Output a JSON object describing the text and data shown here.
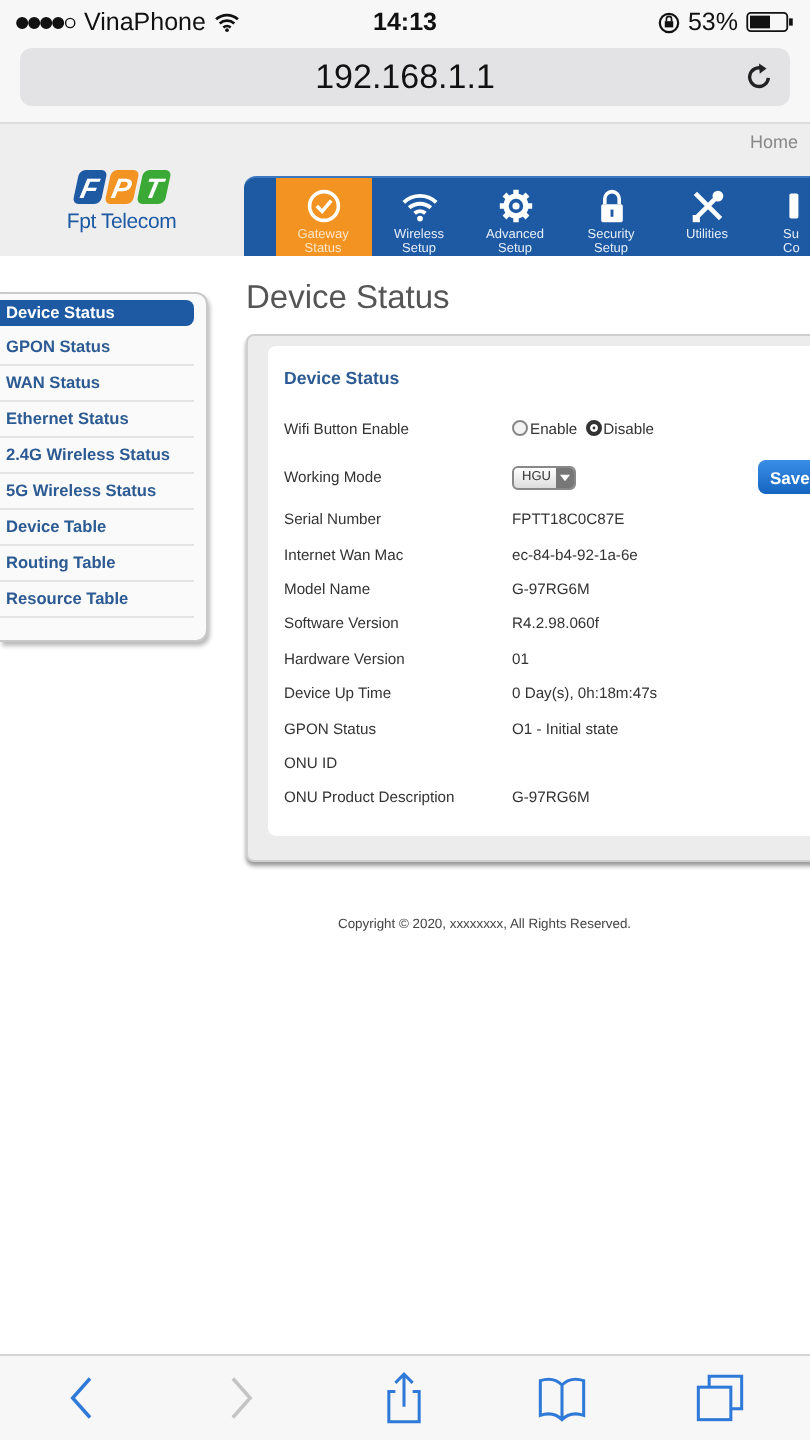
{
  "status_bar": {
    "carrier": "VinaPhone",
    "time": "14:13",
    "battery": "53%"
  },
  "url_bar": {
    "address": "192.168.1.1"
  },
  "header": {
    "breadcrumb": "Home",
    "logo": {
      "letters": [
        "F",
        "P",
        "T"
      ],
      "name": "Fpt Telecom"
    }
  },
  "nav": [
    {
      "kind": "check",
      "lines": [
        "Gateway",
        "Status"
      ],
      "selected": true
    },
    {
      "kind": "wifi",
      "lines": [
        "Wireless",
        "Setup"
      ],
      "selected": false
    },
    {
      "kind": "gear",
      "lines": [
        "Advanced",
        "Setup"
      ],
      "selected": false
    },
    {
      "kind": "lock",
      "lines": [
        "Security",
        "Setup"
      ],
      "selected": false
    },
    {
      "kind": "tools",
      "lines": [
        "Utilities"
      ],
      "selected": false
    },
    {
      "kind": "partial",
      "lines": [
        "Su",
        "Co"
      ],
      "selected": false
    }
  ],
  "sidebar": {
    "items": [
      {
        "label": "Device Status",
        "selected": true
      },
      {
        "label": "GPON Status",
        "selected": false
      },
      {
        "label": "WAN Status",
        "selected": false
      },
      {
        "label": "Ethernet Status",
        "selected": false
      },
      {
        "label": "2.4G Wireless Status",
        "selected": false
      },
      {
        "label": "5G Wireless Status",
        "selected": false
      },
      {
        "label": "Device Table",
        "selected": false
      },
      {
        "label": "Routing Table",
        "selected": false
      },
      {
        "label": "Resource Table",
        "selected": false
      }
    ]
  },
  "main": {
    "title": "Device Status",
    "panel_title": "Device Status",
    "rows": [
      {
        "kind": "radio",
        "label": "Wifi Button Enable",
        "options": [
          {
            "label": "Enable",
            "selected": false
          },
          {
            "label": "Disable",
            "selected": true
          }
        ]
      },
      {
        "kind": "select",
        "label": "Working Mode",
        "value": "HGU",
        "button": "Save"
      },
      {
        "kind": "text",
        "label": "Serial Number",
        "value": "FPTT18C0C87E"
      },
      {
        "kind": "text",
        "label": "Internet Wan Mac",
        "value": "ec-84-b4-92-1a-6e"
      },
      {
        "kind": "text",
        "label": "Model Name",
        "value": "G-97RG6M"
      },
      {
        "kind": "text",
        "label": "Software Version",
        "value": "R4.2.98.060f"
      },
      {
        "kind": "text",
        "label": "Hardware Version",
        "value": "01"
      },
      {
        "kind": "text",
        "label": "Device Up Time",
        "value": "0 Day(s), 0h:18m:47s"
      },
      {
        "kind": "text",
        "label": "GPON Status",
        "value": "O1 - Initial state"
      },
      {
        "kind": "text",
        "label": "ONU ID"
      },
      {
        "kind": "text",
        "label": "ONU Product Description",
        "value": "G-97RG6M"
      }
    ]
  },
  "footer": {
    "copyright": "Copyright © 2020, xxxxxxxx, All Rights Reserved."
  },
  "toolbar": {
    "buttons": [
      {
        "kind": "back",
        "disabled": false
      },
      {
        "kind": "forward",
        "disabled": true
      },
      {
        "kind": "share",
        "disabled": false
      },
      {
        "kind": "bookmarks",
        "disabled": false
      },
      {
        "kind": "tabs",
        "disabled": false
      }
    ]
  }
}
